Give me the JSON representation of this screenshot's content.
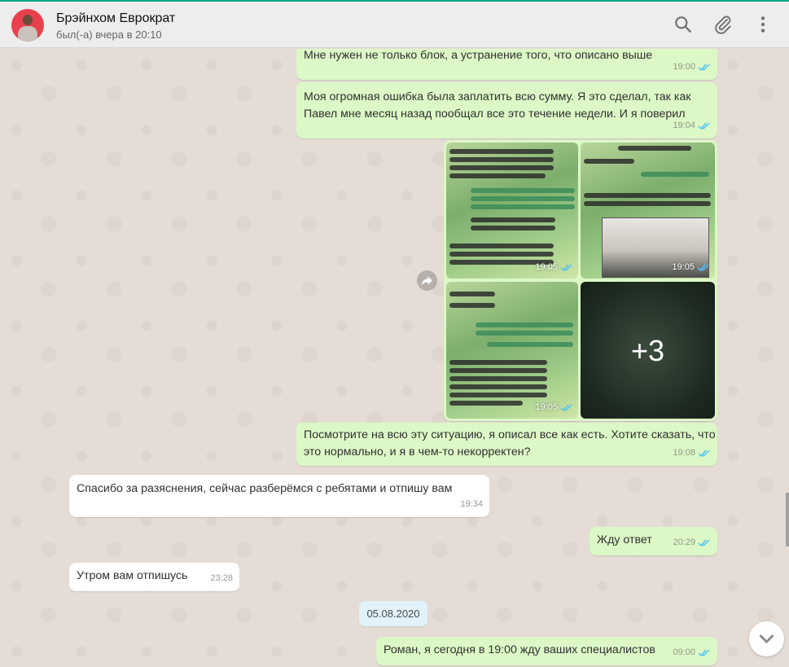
{
  "header": {
    "contact_name": "Брэйнхом Еврократ",
    "status": "был(-а) вчера в 20:10",
    "icons": [
      "search-icon",
      "attach-icon",
      "menu-icon"
    ]
  },
  "colors": {
    "outgoing": "#dcf8c6",
    "incoming": "#ffffff",
    "ticks": "#4fc3f7",
    "accent": "#00a884"
  },
  "messages": [
    {
      "dir": "out",
      "text": "Мне нужен не только блок, а устранение того, что описано выше",
      "time": "19:00"
    },
    {
      "dir": "out",
      "lines": [
        "Моя огромная ошибка была заплатить всю сумму. Я это сделал, так как",
        "Павел мне месяц назад пообщал все это течение недели. И я поверил"
      ],
      "time": "19:04"
    },
    {
      "dir": "out",
      "type": "album",
      "images": [
        {
          "time": "19:05",
          "icon": "chat-screenshot"
        },
        {
          "time": "19:05",
          "icon": "chat-screenshot"
        },
        {
          "time": "19:05",
          "icon": "chat-screenshot"
        },
        {
          "overlay": "+3"
        }
      ]
    },
    {
      "dir": "out",
      "lines": [
        "Посмотрите на всю эту ситуацию, я описал все как есть. Хотите сказать, что",
        "это нормально, и я в чем-то некорректен?"
      ],
      "time": "19:08"
    },
    {
      "dir": "in",
      "text": "Спасибо за разяснения, сейчас разберёмся с ребятами и отпишу вам",
      "time": "19:34"
    },
    {
      "dir": "out",
      "text": "Жду ответ",
      "time": "20:29"
    },
    {
      "dir": "in",
      "text": "Утром вам отпишусь",
      "time": "23:28"
    },
    {
      "dir": "out",
      "text": "Роман, я сегодня в 19:00 жду ваших специалистов",
      "time": "09:00"
    }
  ],
  "date_separator": "05.08.2020"
}
